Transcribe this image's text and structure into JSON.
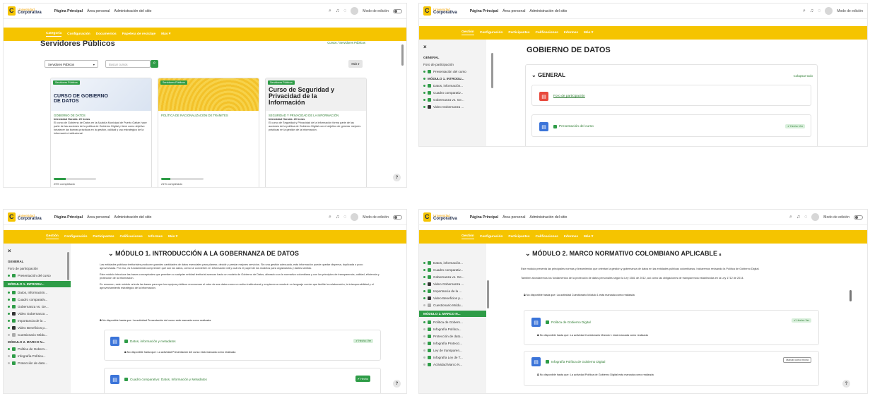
{
  "header": {
    "logo_top": "Universidad",
    "logo_bottom": "Corporativa",
    "nav": [
      "Página Principal",
      "Área personal",
      "Administración del sitio"
    ],
    "edit_mode": "Modo de edición"
  },
  "course_nav": [
    "Gestión",
    "Configuración",
    "Participantes",
    "Calificaciones",
    "Informes",
    "Más ▾"
  ],
  "course_nav_a": [
    "Categoría",
    "Configuración",
    "Documentos",
    "Papelera de reciclaje",
    "Más ▾"
  ],
  "s1": {
    "title": "Servidores Públicos",
    "crumbs": "Cursos / Servidores Públicos",
    "filter": "Servidores Públicos",
    "search_placeholder": "Buscar cursos",
    "more": "Más ▾",
    "cards": [
      {
        "cat": "Servidores Públicos",
        "img_text": "CURSO DE GOBIERNO DE DATOS",
        "title": "GOBIERNO DE DATOS",
        "meta": "Intensidad Horaria: 20 horas",
        "desc": "El curso de Gobierno de Datos en la Alcaldía Municipal de Puerto Gaitán hace parte de las acciones de la política de Gobierno Digital y tiene como objetivo fortalecer las buenas prácticas en la gestión, calidad y uso estratégico de la información institucional.",
        "progress": 29,
        "pct": "29% completado"
      },
      {
        "cat": "Servidores Públicos",
        "img_text": "",
        "title": "POLÍTICA DE RACIONALIZACIÓN DE TRÁMITES",
        "meta": "",
        "desc": "",
        "progress": 21,
        "pct": "21% completado"
      },
      {
        "cat": "Servidores Públicos",
        "img_text": "Curso de Seguridad y Privacidad de la Información",
        "title": "SEGURIDAD Y PRIVACIDAD DE LA INFORMACIÓN",
        "meta": "Intensidad Horaria: 20 horas",
        "desc": "El curso de Seguridad y Privacidad de la Información forma parte de las acciones de la política de Gobierno Digital con el objetivo de generar mejores prácticas en la gestión de la información.",
        "progress": 0,
        "pct": ""
      }
    ]
  },
  "s2": {
    "title": "GOBIERNO DE DATOS",
    "section": "GENERAL",
    "collapse": "Colapsar todo",
    "forum": "Foro de participación",
    "presentation": "Presentación del curso",
    "done": "✔ Hecho: Ver",
    "sidebar": [
      "GENERAL",
      "Foro de participación",
      "Presentación del curso",
      "MÓDULO 1. INTRODU...",
      "Datos, información...",
      "Cuadro comparativ...",
      "Gobernanza vs. Ge...",
      "Video Gobernanza ..."
    ]
  },
  "s3": {
    "title": "MÓDULO 1. INTRODUCCIÓN A LA GOBERNANZA DE DATOS",
    "p1": "Las entidades públicas territoriales producen grandes cantidades de datos esenciales para planear, decidir y prestar mejores servicios. Sin una gestión adecuada, esta información puede quedar dispersa, duplicada o poco aprovechada. Por eso, es fundamental comprender qué son los datos, cómo se convierten en información útil y cuál es el papel de los modelos para organizarlos y darles sentido.",
    "p2": "Este módulo introduce las bases conceptuales que permiten a cualquier entidad territorial avanzar hacia un modelo de Gobierno de Datos, alineado con la normativa colombiana y con los principios de transparencia, calidad, eficiencia y protección de la información.",
    "p3": "En resumen, este módulo orienta las bases para que los equipos públicos reconozcan el valor de sus datos como un activo institucional y empiecen a construir un lenguaje común que facilite la colaboración, la interoperabilidad y el aprovechamiento estratégico de la información.",
    "restrict": "No disponible hasta que: La actividad  Presentación del curso  está marcada como realizada",
    "act1": "Datos, información y metadatos",
    "act1_restrict": "No disponible hasta que: La actividad  Presentación del curso  está marcada como realizada",
    "act2": "Cuadro comparativo: Datos, Información y Metadatos",
    "done": "✔ Hecho: Ver",
    "done2": "✔ Hecho",
    "sidebar": [
      "GENERAL",
      "Foro de participación",
      "Presentación del curso",
      "MÓDULO 1. INTRODU...",
      "Datos, información...",
      "Cuadro comparativ...",
      "Gobernanza vs. Ge...",
      "Video Gobernanza ...",
      "Importancia de la ...",
      "Video Beneficios p...",
      "Cuestionario Módu...",
      "MÓDULO 2. MARCO N...",
      "Política de Gobern...",
      "Infografía Política...",
      "Protección de dato..."
    ]
  },
  "s4": {
    "title": "MÓDULO 2. MARCO NORMATIVO COLOMBIANO APLICABLE",
    "p1": "Este módulo presenta las principales normas y lineamientos que orientan la gestión y gobernanza de datos en las entidades públicas colombianas. Iniciaremos revisando la Política de Gobierno Digital.",
    "p2": "También abordaremos los fundamentos de la protección de datos personales según la Ley 1581 de 2012, así como las obligaciones de transparencia establecidas en la Ley 1712 de 2014.",
    "restrict": "No disponible hasta que: La actividad  Cuestionario Módulo 1  está marcada como realizada",
    "act1": "Política de Gobierno Digital",
    "act1_restrict": "No disponible hasta que: La actividad  Cuestionario Módulo 1  está marcada como realizada",
    "act2": "Infografía Política de Gobierno Digital",
    "act2_restrict": "No disponible hasta que: La actividad  Política de Gobierno Digital  está marcada como realizada",
    "mark_done": "Marcar como hecha",
    "done": "✔ Hecho: Ver",
    "sidebar": [
      "Datos, información...",
      "Cuadro comparativ...",
      "Gobernanza vs. Ge...",
      "Video Gobernanza ...",
      "Importancia de la ...",
      "Video Beneficios p...",
      "Cuestionario Módu...",
      "MÓDULO 2. MARCO N...",
      "Política de Gobern...",
      "Infografía Política...",
      "Protección de dato...",
      "Infografía Protecci...",
      "Ley de transparen...",
      "Infografía Ley de T...",
      "Actividad Marco N..."
    ]
  },
  "colors": {
    "accent": "#f5c400",
    "green": "#2e9c47",
    "blue": "#3b74d9"
  }
}
